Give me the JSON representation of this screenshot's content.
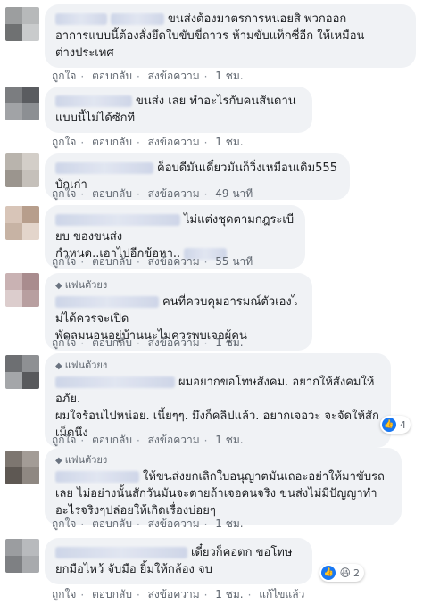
{
  "comments": [
    {
      "badge": "",
      "text": "ขนส่งต้องมาตรการหน่อยสิ พวกออก\nอาการแบบนี้ต้องสั่งยึดใบขับขี่ถาวร ห้ามขับแท็กซี่อีก ให้เหมือน\nต่างประเทศ",
      "like": "ถูกใจ",
      "reply": "ตอบกลับ",
      "message": "ส่งข้อความ",
      "time": "1 ชม.",
      "reactions": ""
    },
    {
      "badge": "",
      "text": "ขนส่ง              เลย ทำอะไรกับคนสันดาน\nแบบนี้ไม่ได้ซักที",
      "like": "ถูกใจ",
      "reply": "ตอบกลับ",
      "message": "ส่งข้อความ",
      "time": "1 ชม.",
      "reactions": ""
    },
    {
      "badge": "",
      "text": "ค็อบดีมันเดี๋ยวมันก็วิ่งเหมือนเดิม555บักเก่า",
      "like": "ถูกใจ",
      "reply": "ตอบกลับ",
      "message": "ส่งข้อความ",
      "time": "49 นาที",
      "reactions": ""
    },
    {
      "badge": "",
      "text": "ไม่แต่งชุดตามกฎระเบียบ ของขนส่ง\nกำหนด..เอาไปอีกข้อหา..",
      "like": "ถูกใจ",
      "reply": "ตอบกลับ",
      "message": "ส่งข้อความ",
      "time": "55 นาที",
      "reactions": ""
    },
    {
      "badge": "แฟนตัวยง",
      "text": "คนที่ควบคุมอารมณ์ตัวเองไม่ได้ควรจะเปิด\nพัดลมนอนอยู่บ้านนะไม่ควรพบเจอผู้คน",
      "like": "ถูกใจ",
      "reply": "ตอบกลับ",
      "message": "ส่งข้อความ",
      "time": "1 ชม.",
      "reactions": ""
    },
    {
      "badge": "แฟนตัวยง",
      "text": "ผมอยากขอโทษสังคม. อยากให้สังคมให้อภัย.\nผมใจร้อนไปหน่อย. เนี้ยๆๆ. มึงก็คลิปแล้ว. อยากเจอวะ จะจัดให้สัก\nเม็ดนึง",
      "like": "ถูกใจ",
      "reply": "ตอบกลับ",
      "message": "ส่งข้อความ",
      "time": "1 ชม.",
      "reactions": "4"
    },
    {
      "badge": "แฟนตัวยง",
      "text": "ให้ขนส่งยกเลิกใบอนุญาตมันเถอะอย่าให้มาขับรถ\nเลย ไม่อย่างนั้นสักวันมันจะตายถ้าเจอคนจริง ขนส่งไม่มีปัญญาทำ\nอะไรจริงๆปล่อยให้เกิดเรื่องบ่อยๆ",
      "like": "ถูกใจ",
      "reply": "ตอบกลับ",
      "message": "ส่งข้อความ",
      "time": "1 ชม.",
      "reactions": ""
    },
    {
      "badge": "",
      "text": "เดี๋ยวก็คอตก ขอโทษ\nยกมือไหว้ จับมือ ยิ้มให้กล้อง จบ",
      "like": "ถูกใจ",
      "reply": "ตอบกลับ",
      "message": "ส่งข้อความ",
      "time": "1 ชม.",
      "edited": "แก้ไขแล้ว",
      "reactions": "2"
    }
  ],
  "colors": {
    "bubble": "#f0f2f5",
    "like_blue": "#1877f2",
    "meta_gray": "#606770"
  },
  "icons": {
    "badge": "diamond-icon",
    "like": "thumbs-up-icon",
    "haha": "laugh-emoji-icon"
  }
}
